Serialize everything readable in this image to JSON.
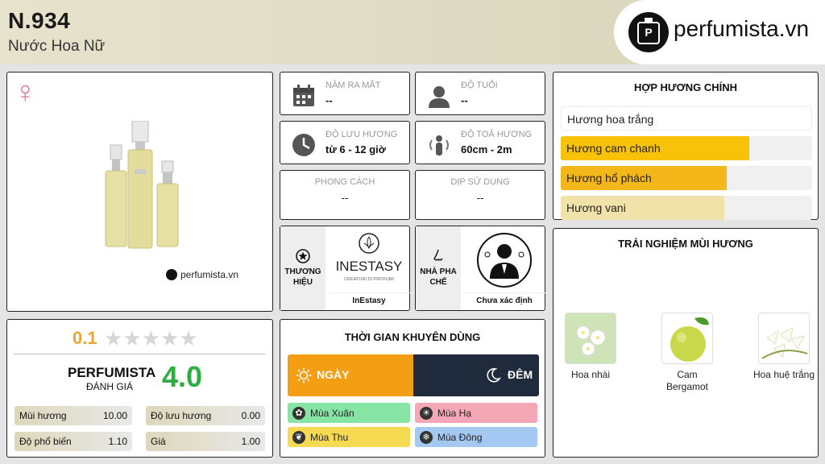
{
  "header": {
    "code": "N.934",
    "subtitle": "Nước Hoa Nữ",
    "brand": "perfumista.vn"
  },
  "product": {
    "gender_icon": "female-symbol-icon",
    "watermark": "perfumista.vn"
  },
  "rating": {
    "user_score": "0.1",
    "stars_max": 5,
    "stars_filled": 0,
    "perfumista_label": "PERFUMISTA",
    "perfumista_sub": "ĐÁNH GIÁ",
    "perfumista_score": "4.0",
    "stats": [
      {
        "label": "Mùi hương",
        "value": "10.00"
      },
      {
        "label": "Độ lưu hương",
        "value": "0.00"
      },
      {
        "label": "Độ phổ biến",
        "value": "1.10"
      },
      {
        "label": "Giá",
        "value": "1.00"
      }
    ]
  },
  "info": {
    "release": {
      "label": "NĂM RA MẮT",
      "value": "--",
      "icon": "calendar-icon"
    },
    "age": {
      "label": "ĐỘ TUỔI",
      "value": "--",
      "icon": "person-icon"
    },
    "longevity": {
      "label": "ĐỘ LƯU HƯƠNG",
      "value": "từ 6 - 12 giờ",
      "icon": "clock-icon"
    },
    "sillage": {
      "label": "ĐỘ TOẢ HƯƠNG",
      "value": "60cm - 2m",
      "icon": "sillage-icon"
    },
    "style": {
      "label": "PHONG CÁCH",
      "value": "--"
    },
    "occasion": {
      "label": "DỊP SỬ DỤNG",
      "value": "--"
    }
  },
  "brand_box": {
    "label": "THƯƠNG HIỆU",
    "logo_text": "INESTASY",
    "logo_sub": "CREATORI DI PROFUMI",
    "name": "InEstasy"
  },
  "perfumer_box": {
    "label": "NHÀ PHA CHẾ",
    "name": "Chưa xác định"
  },
  "accords": {
    "title": "HỢP HƯƠNG CHÍNH",
    "items": [
      {
        "label": "Hương hoa trắng",
        "value": 0.0,
        "color": "#ffffff"
      },
      {
        "label": "Hương cam chanh",
        "value": 0.75,
        "color": "#f8c20a"
      },
      {
        "label": "Hương hổ phách",
        "value": 0.66,
        "color": "#f4b71a"
      },
      {
        "label": "Hương vani",
        "value": 0.65,
        "color": "#f1e2aa"
      }
    ]
  },
  "experience": {
    "title": "TRẢI NGHIỆM MÙI HƯƠNG",
    "items": [
      {
        "label": "Hoa nhài"
      },
      {
        "label": "Cam Bergamot"
      },
      {
        "label": "Hoa huệ trắng"
      }
    ]
  },
  "time": {
    "title": "THỜI GIAN KHUYÊN DÙNG",
    "day": "NGÀY",
    "night": "ĐÊM",
    "seasons": [
      {
        "label": "Mùa Xuân",
        "color": "#86e5a4"
      },
      {
        "label": "Mùa Hạ",
        "color": "#f6a7b6"
      },
      {
        "label": "Mùa Thu",
        "color": "#f6da52"
      },
      {
        "label": "Mùa Đông",
        "color": "#a3c8f1"
      }
    ]
  }
}
